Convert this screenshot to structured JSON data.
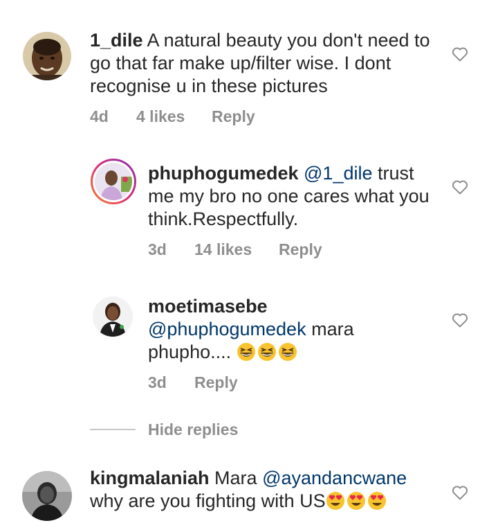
{
  "comments": [
    {
      "username": "1_dile",
      "text": " A natural beauty you don't need to go that far make up/filter wise. I dont recognise u in these pictures",
      "time": "4d",
      "likes": "4 likes",
      "reply": "Reply"
    },
    {
      "username": "phuphogumedek",
      "mention": "@1_dile",
      "text": " trust me my bro no one cares what you think.Respectfully.",
      "time": "3d",
      "likes": "14 likes",
      "reply": "Reply"
    },
    {
      "username": "moetimasebe",
      "mention": "@phuphogumedek",
      "text": " mara phupho.... ",
      "emoji": "grinning-squinting-face x3",
      "time": "3d",
      "reply": "Reply"
    },
    {
      "username": "kingmalaniah",
      "text_before": " Mara ",
      "mention": "@ayandancwane",
      "text_after": " why are you fighting with US",
      "emoji": "heart-eyes-face x3"
    }
  ],
  "hide_replies": "Hide replies",
  "colors": {
    "text": "#262626",
    "meta": "#8e8e8e",
    "mention": "#00376b",
    "story_ring_start": "#f58529",
    "story_ring_end": "#dd2a7b"
  },
  "icons": [
    "heart-outline-icon",
    "grin-squint-emoji",
    "heart-eyes-emoji"
  ]
}
